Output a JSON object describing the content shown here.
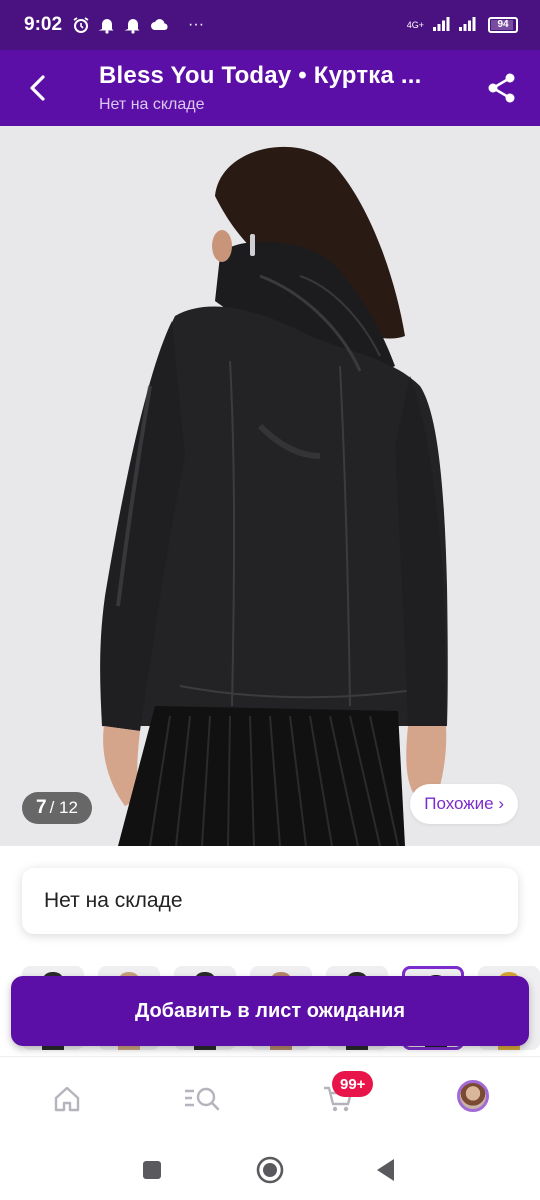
{
  "status_bar": {
    "time": "9:02",
    "more": "···",
    "network": "4G+",
    "battery": "94"
  },
  "header": {
    "title": "Bless You Today • Куртка ...",
    "subtitle": "Нет на складе"
  },
  "gallery": {
    "current": "7",
    "separator": "/ 12",
    "similar_label": "Похожие ›"
  },
  "stock": {
    "label": "Нет на складе"
  },
  "actions": {
    "waitlist_label": "Добавить в лист ожидания"
  },
  "bottom_nav": {
    "cart_badge": "99+",
    "items": [
      "home-icon",
      "catalog-search-icon",
      "cart-icon",
      "profile-avatar"
    ]
  },
  "colors": {
    "header_bg": "#5c0fa6",
    "status_bg": "#4a1280",
    "accent": "#7b2ccc",
    "badge": "#e8154b"
  }
}
